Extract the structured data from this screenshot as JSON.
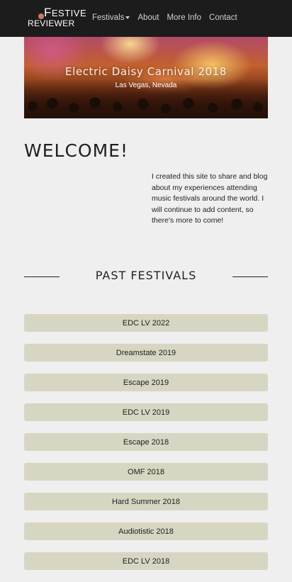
{
  "brand": {
    "line1_initial": "F",
    "line1_rest": "ESTIVE",
    "line2": "REVIEWER"
  },
  "nav": {
    "items": [
      "Festivals",
      "About",
      "More Info",
      "Contact"
    ]
  },
  "hero": {
    "title": "Electric Daisy Carnival 2018",
    "subtitle": "Las Vegas, Nevada"
  },
  "welcome": {
    "heading": "WELCOME!",
    "body": "I created this site to share and blog about my experiences attending music festivals around the world. I will continue to add content, so there's more to come!"
  },
  "past": {
    "heading": "PAST FESTIVALS",
    "items": [
      "EDC LV 2022",
      "Dreamstate 2019",
      "Escape 2019",
      "EDC LV 2019",
      "Escape 2018",
      "OMF 2018",
      "Hard Summer 2018",
      "Audiotistic 2018",
      "EDC LV 2018"
    ]
  },
  "colors": {
    "navbar": "#1c1c1c",
    "background": "#efefef",
    "button": "#d6d6c2",
    "logo_accent": "#c9796b"
  }
}
